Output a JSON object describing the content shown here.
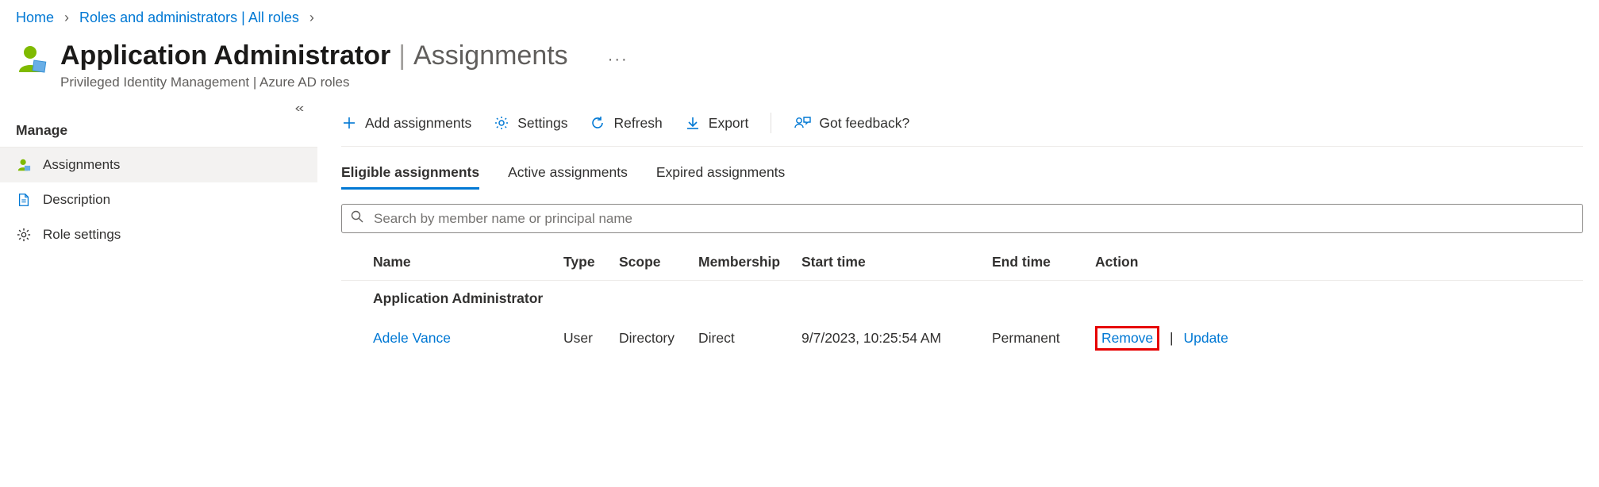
{
  "breadcrumb": {
    "items": [
      "Home",
      "Roles and administrators | All roles"
    ]
  },
  "header": {
    "title_main": "Application Administrator",
    "title_section": "Assignments",
    "subtitle": "Privileged Identity Management | Azure AD roles"
  },
  "sidebar": {
    "heading": "Manage",
    "items": [
      {
        "label": "Assignments",
        "icon": "person-icon",
        "selected": true
      },
      {
        "label": "Description",
        "icon": "document-icon",
        "selected": false
      },
      {
        "label": "Role settings",
        "icon": "gear-icon",
        "selected": false
      }
    ]
  },
  "toolbar": {
    "add": "Add assignments",
    "settings": "Settings",
    "refresh": "Refresh",
    "export": "Export",
    "feedback": "Got feedback?"
  },
  "tabs": [
    {
      "label": "Eligible assignments",
      "active": true
    },
    {
      "label": "Active assignments",
      "active": false
    },
    {
      "label": "Expired assignments",
      "active": false
    }
  ],
  "search": {
    "placeholder": "Search by member name or principal name",
    "value": ""
  },
  "table": {
    "columns": [
      "Name",
      "Type",
      "Scope",
      "Membership",
      "Start time",
      "End time",
      "Action"
    ],
    "group_label": "Application Administrator",
    "rows": [
      {
        "name": "Adele Vance",
        "type": "User",
        "scope": "Directory",
        "membership": "Direct",
        "start_time": "9/7/2023, 10:25:54 AM",
        "end_time": "Permanent",
        "actions": {
          "remove": "Remove",
          "update": "Update"
        }
      }
    ]
  }
}
